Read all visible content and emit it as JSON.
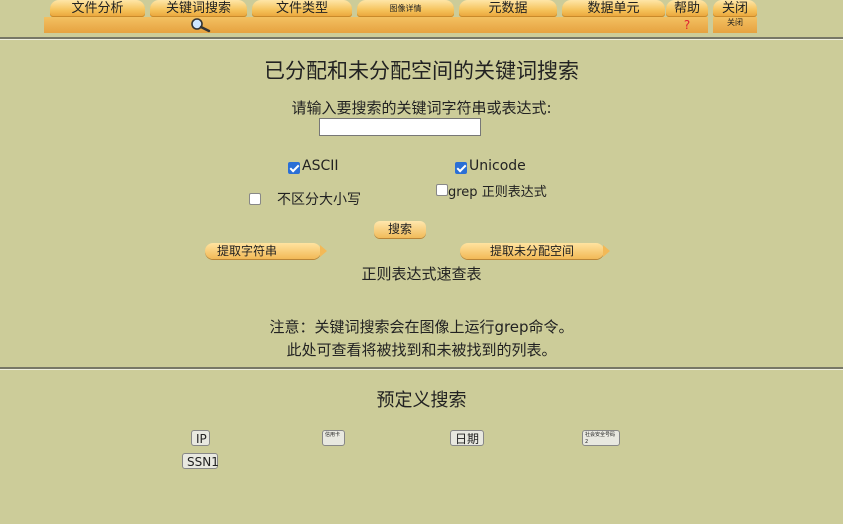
{
  "tabs": {
    "file_analysis": "文件分析",
    "keyword_search": "关键词搜索",
    "file_type": "文件类型",
    "image_details": "图像详情",
    "metadata": "元数据",
    "data_unit": "数据单元",
    "help": "帮助",
    "help_sub": "?",
    "close": "关闭",
    "close_sub": "关闭"
  },
  "main": {
    "title": "已分配和未分配空间的关键词搜索",
    "prompt": "请输入要搜索的关键词字符串或表达式:",
    "keyword_value": "",
    "options": {
      "ascii": "ASCII",
      "ascii_checked": true,
      "unicode": "Unicode",
      "unicode_checked": true,
      "case_insensitive": "不区分大小写",
      "case_insensitive_checked": false,
      "grep_regex": "grep 正则表达式",
      "grep_regex_checked": false
    },
    "search_button": "搜索",
    "extract_strings": "提取字符串",
    "extract_unallocated": "提取未分配空间",
    "regex_cheatsheet": "正则表达式速查表",
    "note_line1": "注意：关键词搜索会在图像上运行grep命令。",
    "note_line2": "此处可查看将被找到和未被找到的列表。"
  },
  "predefined": {
    "title": "预定义搜索",
    "buttons": {
      "ip": "IP",
      "cc": "信用卡",
      "date": "日期",
      "ssn2": "社会安全号码2",
      "ssn1": "SSN1"
    }
  }
}
